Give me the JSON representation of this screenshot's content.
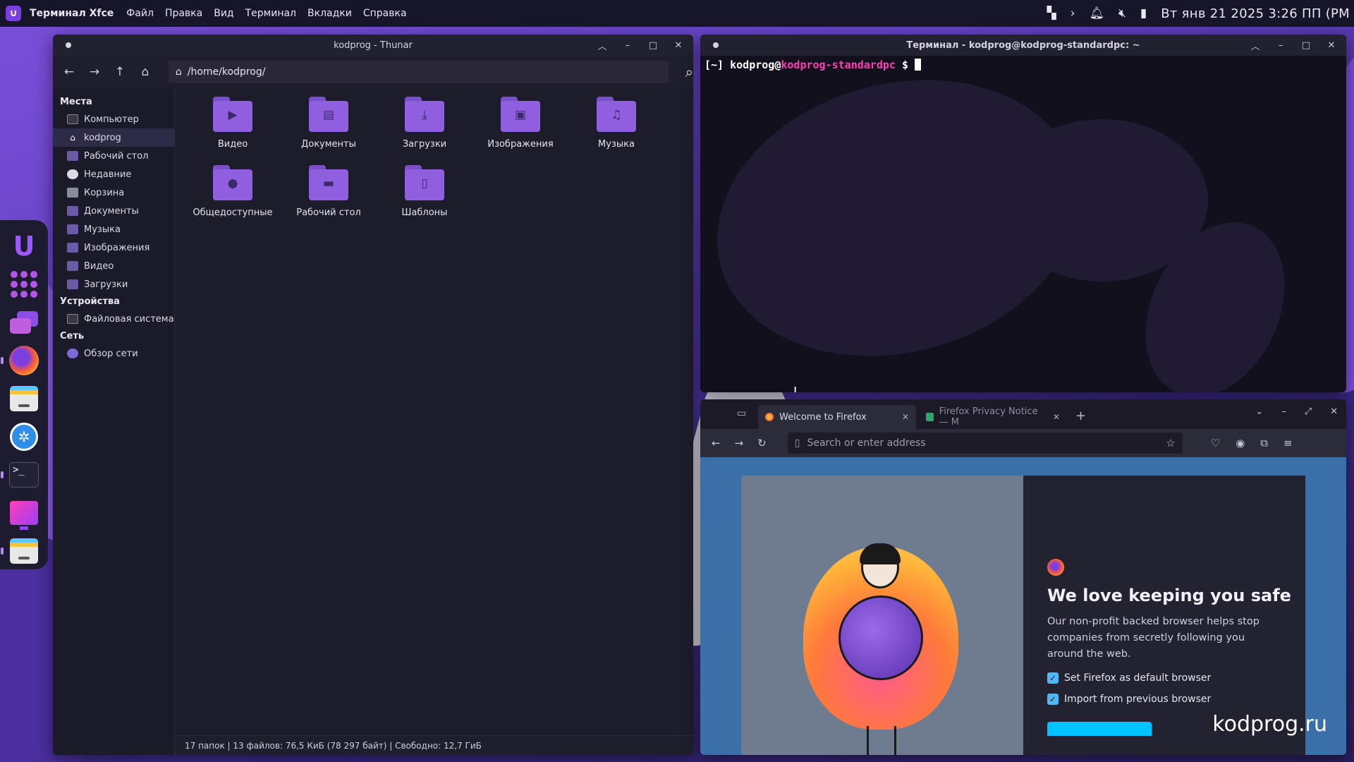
{
  "top_panel": {
    "app_name": "Терминал Xfce",
    "menu": [
      "Файл",
      "Правка",
      "Вид",
      "Терминал",
      "Вкладки",
      "Справка"
    ],
    "clock": "Вт янв 21  2025   3:26 ПП (РМ"
  },
  "thunar": {
    "title": "kodprog - Thunar",
    "path": "/home/kodprog/",
    "sidebar": {
      "places_header": "Места",
      "places": [
        "Компьютер",
        "kodprog",
        "Рабочий стол",
        "Недавние",
        "Корзина",
        "Документы",
        "Музыка",
        "Изображения",
        "Видео",
        "Загрузки"
      ],
      "devices_header": "Устройства",
      "devices": [
        "Файловая система"
      ],
      "network_header": "Сеть",
      "network": [
        "Обзор сети"
      ]
    },
    "folders": [
      "Видео",
      "Документы",
      "Загрузки",
      "Изображения",
      "Музыка",
      "Общедоступные",
      "Рабочий стол",
      "Шаблоны"
    ],
    "status": "17 папок  |  13 файлов: 76,5 КиБ (78 297 байт)  |  Свободно: 12,7 ГиБ"
  },
  "terminal": {
    "title": "Терминал - kodprog@kodprog-standardpc: ~",
    "prompt_dir": "[~] ",
    "prompt_user": "kodprog@",
    "prompt_host": "kodprog-standardpc",
    "prompt_sign": " $ "
  },
  "firefox": {
    "tab1": "Welcome to Firefox",
    "tab2": "Firefox Privacy Notice — M",
    "address_placeholder": "Search or enter address",
    "welcome_title": "We love keeping you safe",
    "welcome_desc": "Our non-profit backed browser helps stop companies from secretly following you around the web.",
    "check1": "Set Firefox as default browser",
    "check2": "Import from previous browser"
  },
  "watermark": "kodprog.ru",
  "colors": {
    "accent": "#8f5fe0",
    "prompt_host": "#ff3fb5",
    "checkbox": "#4fb8f5"
  }
}
